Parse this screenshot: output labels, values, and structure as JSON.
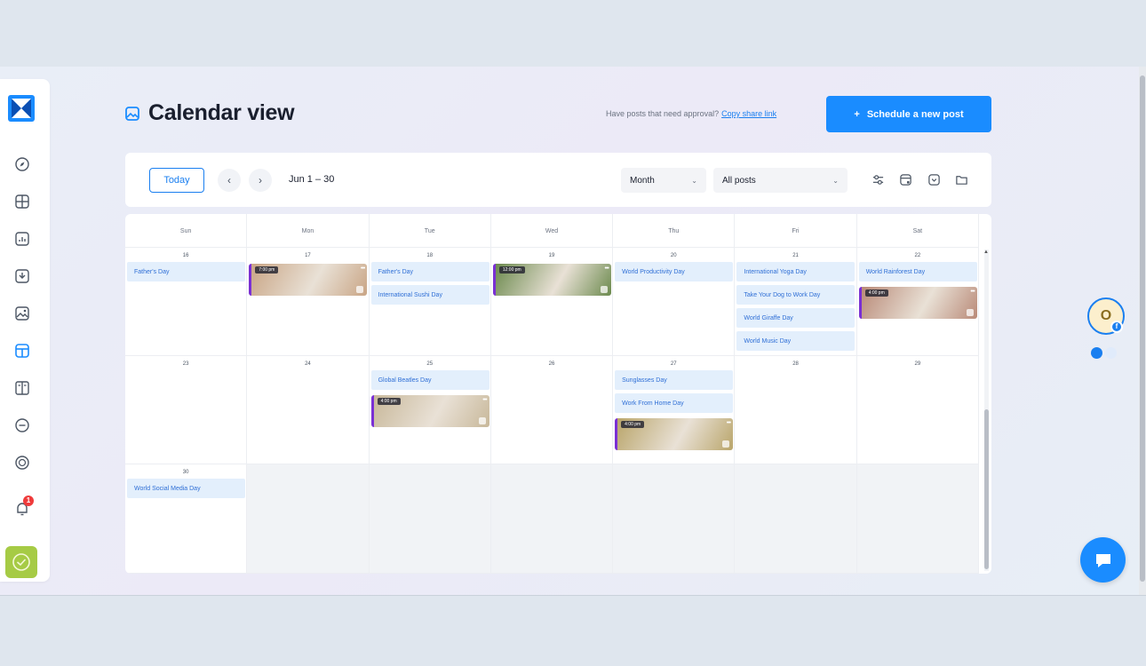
{
  "header": {
    "title": "Calendar view",
    "approval_text": "Have posts that need approval?",
    "approval_link": "Copy share link",
    "schedule_label": "Schedule a new post",
    "schedule_icon": "+"
  },
  "toolbar": {
    "today_label": "Today",
    "range_label": "Jun 1 – 30",
    "view_select": "Month",
    "filter_select": "All posts"
  },
  "sidebar": {
    "notification_count": "1"
  },
  "calendar": {
    "day_names": [
      "Sun",
      "Mon",
      "Tue",
      "Wed",
      "Thu",
      "Fri",
      "Sat"
    ],
    "weeks": [
      [
        {
          "date": "16",
          "events": [
            "Father's Day"
          ],
          "posts": []
        },
        {
          "date": "17",
          "events": [],
          "posts": [
            {
              "time": "7:00 pm",
              "color": "#c9a585"
            }
          ]
        },
        {
          "date": "18",
          "events": [
            "Father's Day",
            "International Sushi Day"
          ],
          "posts": []
        },
        {
          "date": "19",
          "events": [],
          "posts": [
            {
              "time": "12:00 pm",
              "color": "#6c8a4e"
            }
          ]
        },
        {
          "date": "20",
          "events": [
            "World Productivity Day"
          ],
          "posts": []
        },
        {
          "date": "21",
          "events": [
            "International Yoga Day",
            "Take Your Dog to Work Day",
            "World Giraffe Day",
            "World Music Day"
          ],
          "posts": []
        },
        {
          "date": "22",
          "events": [
            "World Rainforest Day"
          ],
          "posts": [
            {
              "time": "4:00 pm",
              "color": "#b98a78"
            }
          ]
        }
      ],
      [
        {
          "date": "23",
          "events": [],
          "posts": []
        },
        {
          "date": "24",
          "events": [],
          "posts": []
        },
        {
          "date": "25",
          "events": [
            "Global Beatles Day"
          ],
          "posts": [
            {
              "time": "4:00 pm",
              "color": "#c8b89a"
            }
          ]
        },
        {
          "date": "26",
          "events": [],
          "posts": []
        },
        {
          "date": "27",
          "events": [
            "Sunglasses Day",
            "Work From Home Day"
          ],
          "posts": [
            {
              "time": "4:00 pm",
              "color": "#b9a56a"
            }
          ]
        },
        {
          "date": "28",
          "events": [],
          "posts": []
        },
        {
          "date": "29",
          "events": [],
          "posts": []
        }
      ],
      [
        {
          "date": "30",
          "events": [
            "World Social Media Day"
          ],
          "posts": []
        },
        {
          "date": "",
          "events": [],
          "posts": [],
          "empty": true
        },
        {
          "date": "",
          "events": [],
          "posts": [],
          "empty": true
        },
        {
          "date": "",
          "events": [],
          "posts": [],
          "empty": true
        },
        {
          "date": "",
          "events": [],
          "posts": [],
          "empty": true
        },
        {
          "date": "",
          "events": [],
          "posts": [],
          "empty": true
        },
        {
          "date": "",
          "events": [],
          "posts": [],
          "empty": true
        }
      ]
    ]
  },
  "profile": {
    "avatar_letter": "O",
    "network_badge": "f"
  },
  "colors": {
    "accent": "#1a8cff",
    "event_bg": "#e3effc",
    "event_text": "#2f6fd6",
    "post_border": "#7a2fd4"
  }
}
